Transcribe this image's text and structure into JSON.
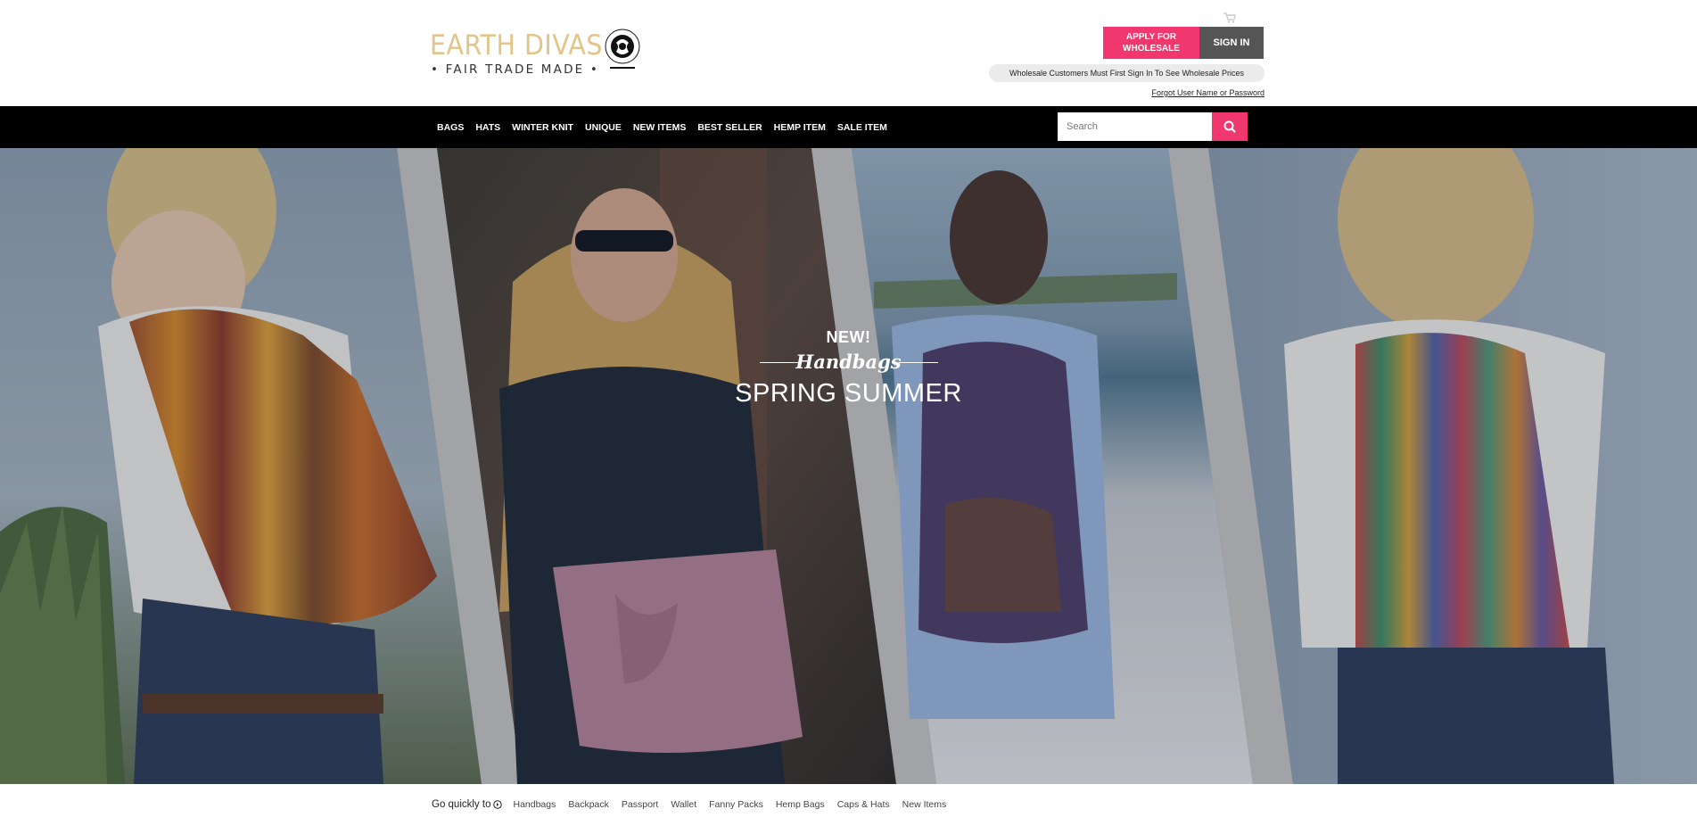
{
  "brand": {
    "name": "EARTH DIVAS",
    "tagline": "• FAIR TRADE MADE •",
    "accent_color": "#f0386f",
    "logo_color": "#e2c588"
  },
  "header": {
    "apply_button": "APPLY FOR WHOLESALE",
    "signin_button": "SIGN IN",
    "notice": "Wholesale Customers Must First Sign In To See Wholesale Prices",
    "forgot_link": "Forgot User Name or Password",
    "cart_icon": "cart-icon"
  },
  "nav": {
    "items": [
      "BAGS",
      "HATS",
      "WINTER KNIT",
      "UNIQUE",
      "NEW ITEMS",
      "BEST SELLER",
      "HEMP ITEM",
      "SALE ITEM"
    ],
    "search_placeholder": "Search",
    "search_icon": "search-icon"
  },
  "hero": {
    "eyebrow": "NEW!",
    "script": "Handbags",
    "title": "SPRING SUMMER"
  },
  "quick_links": {
    "label": "Go quickly to",
    "items": [
      "Handbags",
      "Backpack",
      "Passport",
      "Wallet",
      "Fanny Packs",
      "Hemp Bags",
      "Caps & Hats",
      "New Items"
    ]
  }
}
